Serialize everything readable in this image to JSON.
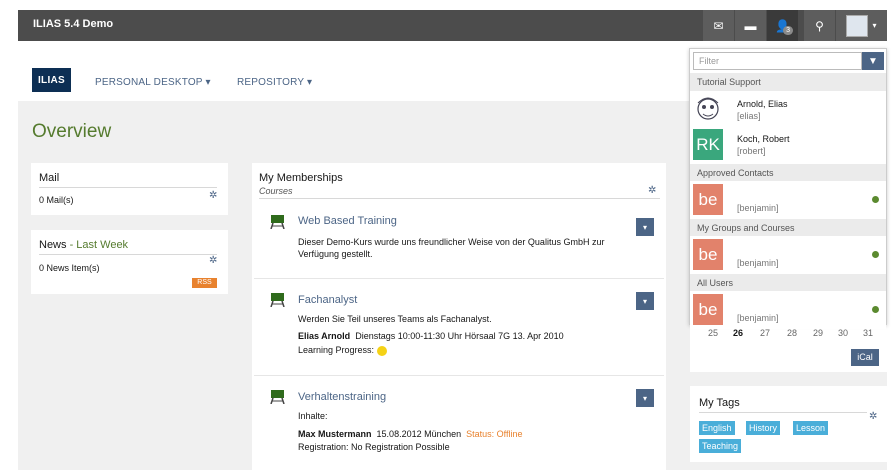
{
  "header": {
    "app_title": "ILIAS 5.4 Demo",
    "badge_count": "3"
  },
  "nav": {
    "logo_text": "ILIAS",
    "personal_desktop": "PERSONAL DESKTOP ▾",
    "repository": "REPOSITORY ▾"
  },
  "page": {
    "title": "Overview"
  },
  "mail_block": {
    "title": "Mail",
    "count": "0 Mail(s)"
  },
  "news_block": {
    "title": "News",
    "title_suffix": " - Last Week",
    "count": "0 News Item(s)",
    "rss": "RSS"
  },
  "memberships": {
    "title": "My Memberships",
    "subtitle": "Courses",
    "courses": [
      {
        "title": "Web Based Training",
        "desc": "Dieser Demo-Kurs wurde uns freundlicher Weise von der Qualitus GmbH zur Verfügung gestellt."
      },
      {
        "title": "Fachanalyst",
        "desc": "Werden Sie Teil unseres Teams als Fachanalyst.",
        "meta_strong": "Elias Arnold",
        "meta": "Dienstags 10:00-11:30 Uhr   Hörsaal 7G   13. Apr 2010",
        "progress_label": "Learning Progress:"
      },
      {
        "title": "Verhaltenstraining",
        "desc": "Inhalte:",
        "meta_strong": "Max Mustermann",
        "meta": "15.08.2012   München",
        "status": "Status: Offline",
        "registration": "Registration: No Registration Possible"
      }
    ]
  },
  "popover": {
    "filter_placeholder": "Filter",
    "sections": [
      {
        "label": "Tutorial Support"
      },
      {
        "label": "Approved Contacts"
      },
      {
        "label": "My Groups and Courses"
      },
      {
        "label": "All Users"
      }
    ],
    "users": [
      {
        "name": "Arnold, Elias",
        "login": "[elias]"
      },
      {
        "name": "Koch, Robert",
        "login": "[robert]",
        "initials": "RK"
      },
      {
        "name": "",
        "login": "[benjamin]",
        "initials": "be"
      },
      {
        "name": "",
        "login": "[benjamin]",
        "initials": "be"
      },
      {
        "name": "",
        "login": "[benjamin]",
        "initials": "be"
      }
    ],
    "status_color": "#5b8a2f"
  },
  "calendar": {
    "days": [
      "25",
      "26",
      "27",
      "28",
      "29",
      "30",
      "31"
    ],
    "ical": "iCal"
  },
  "tags": {
    "title": "My Tags",
    "items": [
      "English",
      "History",
      "Lesson",
      "Teaching"
    ]
  },
  "colors": {
    "accent": "#4c6586",
    "title_green": "#557b2e",
    "avatar_rk": "#3aa77d",
    "avatar_be": "#e2826b",
    "tag_blue": "#4aaed9",
    "status_orange": "#e8822e"
  }
}
